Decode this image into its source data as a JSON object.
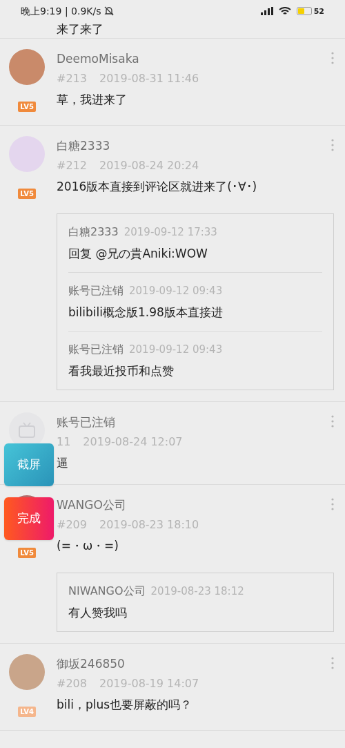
{
  "status_bar": {
    "time": "晚上9:19 | 0.9K/s",
    "battery": "52"
  },
  "top_comment": {
    "text": "来了来了"
  },
  "comments": [
    {
      "kind": "photo",
      "name": "DeemoMisaka",
      "floor": "#213",
      "time": "2019-08-31 11:46",
      "level": "LV5",
      "text": "草，我进来了"
    },
    {
      "kind": "photo",
      "name": "白糖2333",
      "floor": "#212",
      "time": "2019-08-24 20:24",
      "level": "LV5",
      "text": "2016版本直接到评论区就进来了(･∀･)",
      "replies": [
        {
          "name": "白糖2333",
          "time": "2019-09-12 17:33",
          "text": "回复 @兄の貴Aniki:WOW"
        },
        {
          "name": "账号已注销",
          "time": "2019-09-12 09:43",
          "text": "bilibili概念版1.98版本直接进"
        },
        {
          "name": "账号已注销",
          "time": "2019-09-12 09:43",
          "text": "看我最近投币和点赞"
        }
      ]
    },
    {
      "kind": "default",
      "name": "账号已注销",
      "floor": "11",
      "time": "2019-08-24 12:07",
      "text": "逼"
    },
    {
      "kind": "photo",
      "name": "WANGO公司",
      "floor": "#209",
      "time": "2019-08-23 18:10",
      "level": "LV5",
      "text": "(=・ω・=)",
      "replies": [
        {
          "name": "NIWANGO公司",
          "time": "2019-08-23 18:12",
          "text": "有人赞我吗"
        }
      ]
    },
    {
      "kind": "photo",
      "name": "御坂246850",
      "floor": "#208",
      "time": "2019-08-19 14:07",
      "level": "LV4",
      "text": "bili，plus也要屏蔽的吗？"
    }
  ],
  "floating_buttons": [
    {
      "kind": "screenshot",
      "label": "截屏"
    },
    {
      "kind": "done",
      "label": "完成"
    }
  ]
}
